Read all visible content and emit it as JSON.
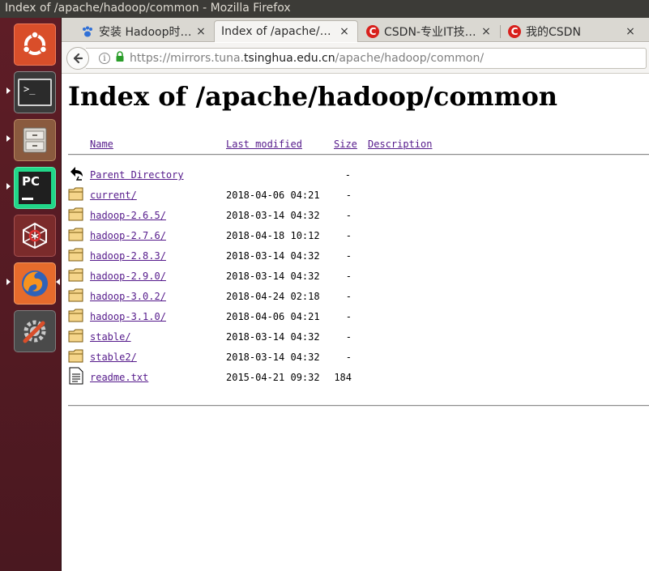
{
  "window": {
    "title": "Index of /apache/hadoop/common - Mozilla Firefox"
  },
  "launcher": {
    "items": [
      {
        "name": "ubuntu-dash-icon"
      },
      {
        "name": "terminal-icon"
      },
      {
        "name": "file-manager-icon"
      },
      {
        "name": "pycharm-icon"
      },
      {
        "name": "network-app-icon"
      },
      {
        "name": "firefox-icon"
      },
      {
        "name": "system-settings-icon"
      }
    ],
    "pycharm_label": "PC",
    "terminal_prompt": ">_"
  },
  "tabs": [
    {
      "label": "安装 Hadoop时…",
      "favicon": "paw-icon",
      "active": false
    },
    {
      "label": "Index of /apache/…",
      "favicon": "none",
      "active": true
    },
    {
      "label": "CSDN-专业IT技…",
      "favicon": "csdn-icon",
      "active": false
    },
    {
      "label": "我的CSDN",
      "favicon": "csdn-icon",
      "active": false
    }
  ],
  "tab_close": "×",
  "csdn_letter": "C",
  "navbar": {
    "url_prefix": "https://mirrors.tuna.",
    "url_domain": "tsinghua.edu.cn",
    "url_path": "/apache/hadoop/common/"
  },
  "page": {
    "heading": "Index of /apache/hadoop/common",
    "columns": {
      "name": "Name",
      "last_modified": "Last modified",
      "size": "Size",
      "description": "Description"
    },
    "parent": {
      "name": "Parent Directory",
      "size": "-"
    },
    "entries": [
      {
        "name": "current/",
        "date": "2018-04-06 04:21",
        "size": "-",
        "type": "folder"
      },
      {
        "name": "hadoop-2.6.5/",
        "date": "2018-03-14 04:32",
        "size": "-",
        "type": "folder"
      },
      {
        "name": "hadoop-2.7.6/",
        "date": "2018-04-18 10:12",
        "size": "-",
        "type": "folder"
      },
      {
        "name": "hadoop-2.8.3/",
        "date": "2018-03-14 04:32",
        "size": "-",
        "type": "folder"
      },
      {
        "name": "hadoop-2.9.0/",
        "date": "2018-03-14 04:32",
        "size": "-",
        "type": "folder"
      },
      {
        "name": "hadoop-3.0.2/",
        "date": "2018-04-24 02:18",
        "size": "-",
        "type": "folder"
      },
      {
        "name": "hadoop-3.1.0/",
        "date": "2018-04-06 04:21",
        "size": "-",
        "type": "folder"
      },
      {
        "name": "stable/",
        "date": "2018-03-14 04:32",
        "size": "-",
        "type": "folder"
      },
      {
        "name": "stable2/",
        "date": "2018-03-14 04:32",
        "size": "-",
        "type": "folder"
      },
      {
        "name": "readme.txt",
        "date": "2015-04-21 09:32",
        "size": "184",
        "type": "file"
      }
    ]
  }
}
